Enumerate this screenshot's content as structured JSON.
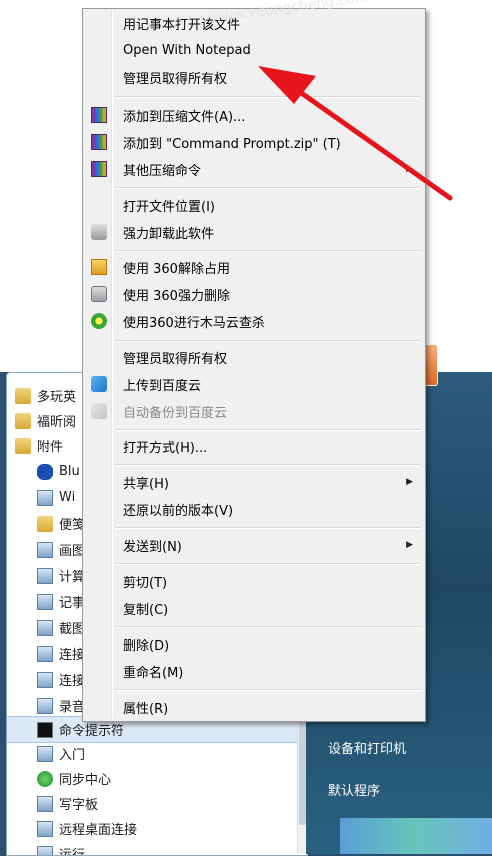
{
  "context_menu": {
    "items": [
      {
        "label": "用记事本打开该文件"
      },
      {
        "label": "Open With Notepad"
      },
      {
        "label": "管理员取得所有权"
      },
      {
        "label": "添加到压缩文件(A)..."
      },
      {
        "label": "添加到 \"Command Prompt.zip\" (T)"
      },
      {
        "label": "其他压缩命令"
      },
      {
        "label": "打开文件位置(I)"
      },
      {
        "label": "强力卸载此软件"
      },
      {
        "label": "使用 360解除占用"
      },
      {
        "label": "使用 360强力删除"
      },
      {
        "label": "使用360进行木马云查杀"
      },
      {
        "label": "管理员取得所有权"
      },
      {
        "label": "上传到百度云"
      },
      {
        "label": "自动备份到百度云"
      },
      {
        "label": "打开方式(H)..."
      },
      {
        "label": "共享(H)"
      },
      {
        "label": "还原以前的版本(V)"
      },
      {
        "label": "发送到(N)"
      },
      {
        "label": "剪切(T)"
      },
      {
        "label": "复制(C)"
      },
      {
        "label": "删除(D)"
      },
      {
        "label": "重命名(M)"
      },
      {
        "label": "属性(R)"
      }
    ],
    "submenu_arrow": "▶"
  },
  "start_menu": {
    "programs": [
      {
        "label": "多玩英"
      },
      {
        "label": "福昕阅"
      },
      {
        "label": "附件"
      },
      {
        "label": "Blu"
      },
      {
        "label": "Wi"
      },
      {
        "label": "便笺"
      },
      {
        "label": "画图"
      },
      {
        "label": "计算"
      },
      {
        "label": "记事"
      },
      {
        "label": "截图"
      },
      {
        "label": "连接"
      },
      {
        "label": "连接"
      },
      {
        "label": "录音"
      },
      {
        "label": "命令提示符"
      },
      {
        "label": "入门"
      },
      {
        "label": "同步中心"
      },
      {
        "label": "写字板"
      },
      {
        "label": "远程桌面连接"
      },
      {
        "label": "运行"
      }
    ],
    "right_items": [
      {
        "label": "设备和打印机"
      },
      {
        "label": "默认程序"
      }
    ]
  },
  "watermark": "www.xitongcheng.com",
  "colors": {
    "arrow": "#e8141c",
    "highlight": "#dbe8f6",
    "menu_bg": "#f0f0f0"
  }
}
